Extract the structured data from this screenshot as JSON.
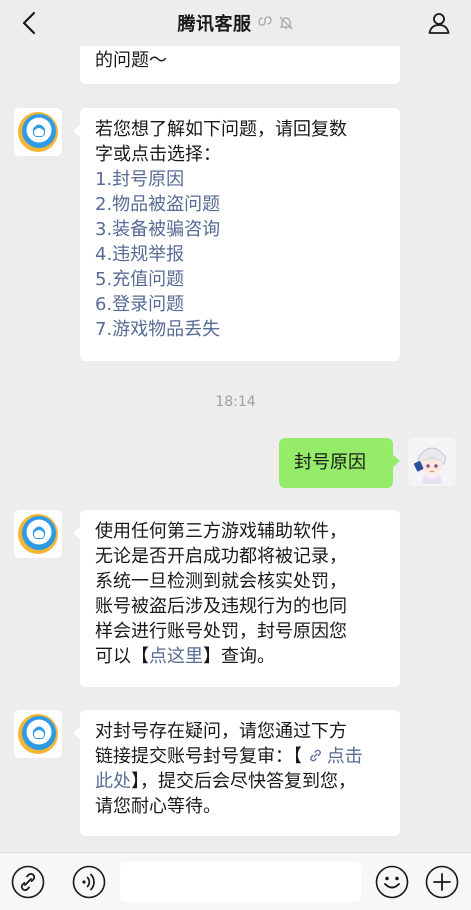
{
  "header": {
    "title": "腾讯客服",
    "icons": [
      "chevron-left-icon",
      "miniprogram-icon",
      "mute-bell-icon",
      "person-icon"
    ]
  },
  "messages": [
    {
      "side": "left",
      "sender": "tencent-service",
      "lines": [
        "的问题～"
      ]
    },
    {
      "side": "left",
      "sender": "tencent-service",
      "intro": [
        "若您想了解如下问题，请回复数",
        "字或点击选择："
      ],
      "options": [
        "1.封号原因",
        "2.物品被盗问题",
        "3.装备被骗咨询",
        "4.违规举报",
        "5.充值问题",
        "6.登录问题",
        "7.游戏物品丢失"
      ]
    },
    {
      "timestamp": "18:14"
    },
    {
      "side": "right",
      "sender": "user",
      "text": "封号原因"
    },
    {
      "side": "left",
      "sender": "tencent-service",
      "lines": [
        "使用任何第三方游戏辅助软件，",
        "无论是否开启成功都将被记录，",
        "系统一旦检测到就会核实处罚，",
        "账号被盗后涉及违规行为的也同",
        "样会进行账号处罚，封号原因您"
      ],
      "last_line_prefix": "可以【",
      "link_text": "点这里",
      "last_line_suffix": "】查询。"
    },
    {
      "side": "left",
      "sender": "tencent-service",
      "line1_prefix": "对封号存在疑问，请您通过下方",
      "line2_prefix": "链接提交账号封号复审：【 ",
      "link_part1": "点击",
      "link_part2": "此处",
      "line3_suffix": "】，提交后会尽快答复到您，",
      "line4": "请您耐心等待。"
    }
  ],
  "inputbar": {
    "input_value": "",
    "icons": [
      "link-icon",
      "voice-icon",
      "emoji-icon",
      "plus-icon"
    ]
  },
  "colors": {
    "background": "#ededed",
    "bubble_left": "#ffffff",
    "bubble_right": "#95ec69",
    "link": "#576b95",
    "timestamp": "#a0a0a0"
  }
}
